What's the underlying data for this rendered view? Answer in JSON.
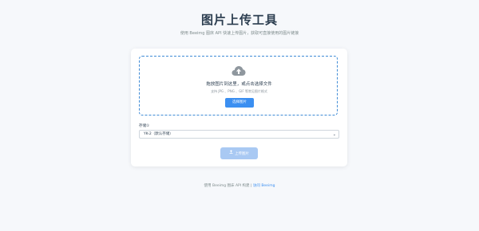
{
  "header": {
    "title": "图片上传工具",
    "subtitle": "使用 Beeimg 图床 API 快速上传图片，获取可直接使用的图片链接"
  },
  "dropzone": {
    "icon": "cloud-upload-icon",
    "text": "拖放图片到这里，或点击选择文件",
    "hint": "支持 JPG 、PNG 、GIF 等常见图片格式",
    "select_label": "选择图片"
  },
  "storage": {
    "label": "存储①",
    "selected": "YK-2（默认存储）"
  },
  "upload": {
    "label": "上传图片",
    "icon": "upload-icon"
  },
  "footer": {
    "text": "使用 Beeimg 图床 API 构建 |",
    "link": "访问 Beeimg"
  },
  "colors": {
    "accent": "#3b8ff1",
    "dropzone_border": "#3f8bd6",
    "disabled_button": "#a9c9f3",
    "background": "#f6f8fb"
  }
}
